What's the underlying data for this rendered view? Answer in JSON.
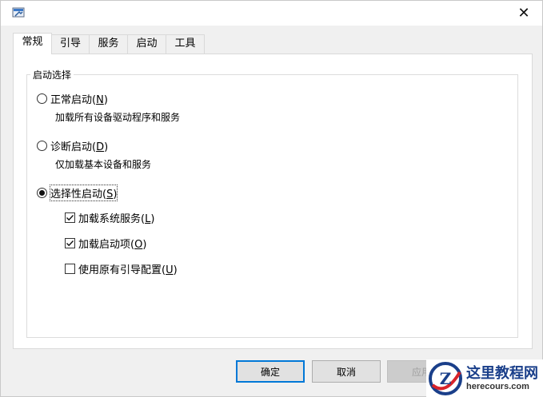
{
  "window": {
    "close_glyph": "✕",
    "app_icon": "msconfig-icon"
  },
  "tabs": [
    {
      "label": "常规",
      "active": true
    },
    {
      "label": "引导",
      "active": false
    },
    {
      "label": "服务",
      "active": false
    },
    {
      "label": "启动",
      "active": false
    },
    {
      "label": "工具",
      "active": false
    }
  ],
  "startup_selection": {
    "group_title": "启动选择",
    "options": [
      {
        "label": "正常启动(",
        "hotkey": "N",
        "suffix": ")",
        "description": "加载所有设备驱动程序和服务",
        "selected": false
      },
      {
        "label": "诊断启动(",
        "hotkey": "D",
        "suffix": ")",
        "description": "仅加载基本设备和服务",
        "selected": false
      },
      {
        "label": "选择性启动(",
        "hotkey": "S",
        "suffix": ")",
        "selected": true
      }
    ],
    "selective_items": [
      {
        "label": "加载系统服务(",
        "hotkey": "L",
        "suffix": ")",
        "checked": true
      },
      {
        "label": "加载启动项(",
        "hotkey": "O",
        "suffix": ")",
        "checked": true
      },
      {
        "label": "使用原有引导配置(",
        "hotkey": "U",
        "suffix": ")",
        "checked": false
      }
    ]
  },
  "buttons": {
    "ok": "确定",
    "cancel": "取消",
    "apply": "应用"
  },
  "watermark": {
    "main": "这里教程网",
    "sub": "herecours.com",
    "logo_letter": "Z"
  },
  "colors": {
    "accent": "#0078d7",
    "watermark_blue": "#1a3f8a",
    "watermark_red": "#d8232a"
  }
}
